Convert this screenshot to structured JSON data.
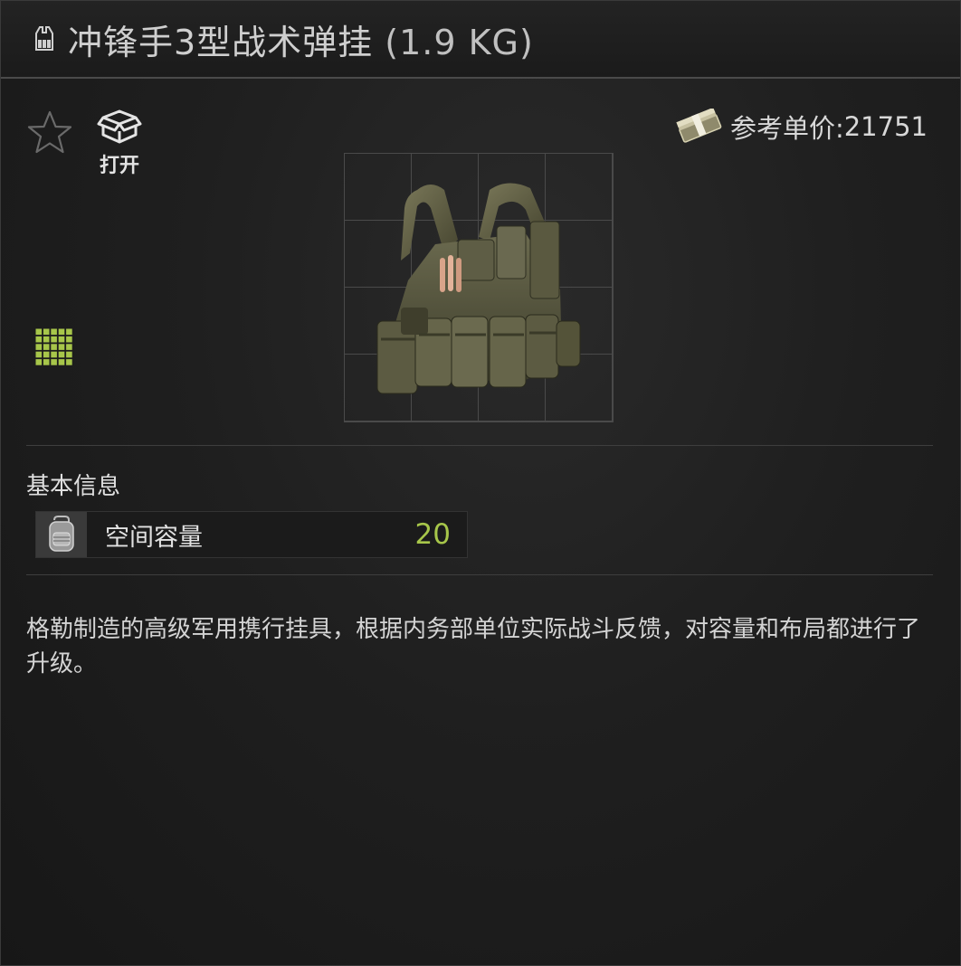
{
  "window": {
    "title_name": "冲锋手3型战术弹挂",
    "title_weight": " (1.9 KG)"
  },
  "toolbar": {
    "open_label": "打开"
  },
  "price": {
    "label": "参考单价:",
    "value": "21751"
  },
  "basic_info": {
    "section_title": "基本信息",
    "stats": [
      {
        "label": "空间容量",
        "value": "20",
        "icon": "backpack-icon"
      }
    ]
  },
  "description": "格勒制造的高级军用携行挂具，根据内务部单位实际战斗反馈，对容量和布局都进行了升级。",
  "icons": {
    "title": "rig-icon",
    "favorite": "star-icon",
    "open": "open-box-icon",
    "price": "money-icon",
    "grid": "grid-icon"
  },
  "colors": {
    "accent_green": "#a7c64a",
    "text": "#d6d6d6",
    "background": "#1f1f1f"
  }
}
